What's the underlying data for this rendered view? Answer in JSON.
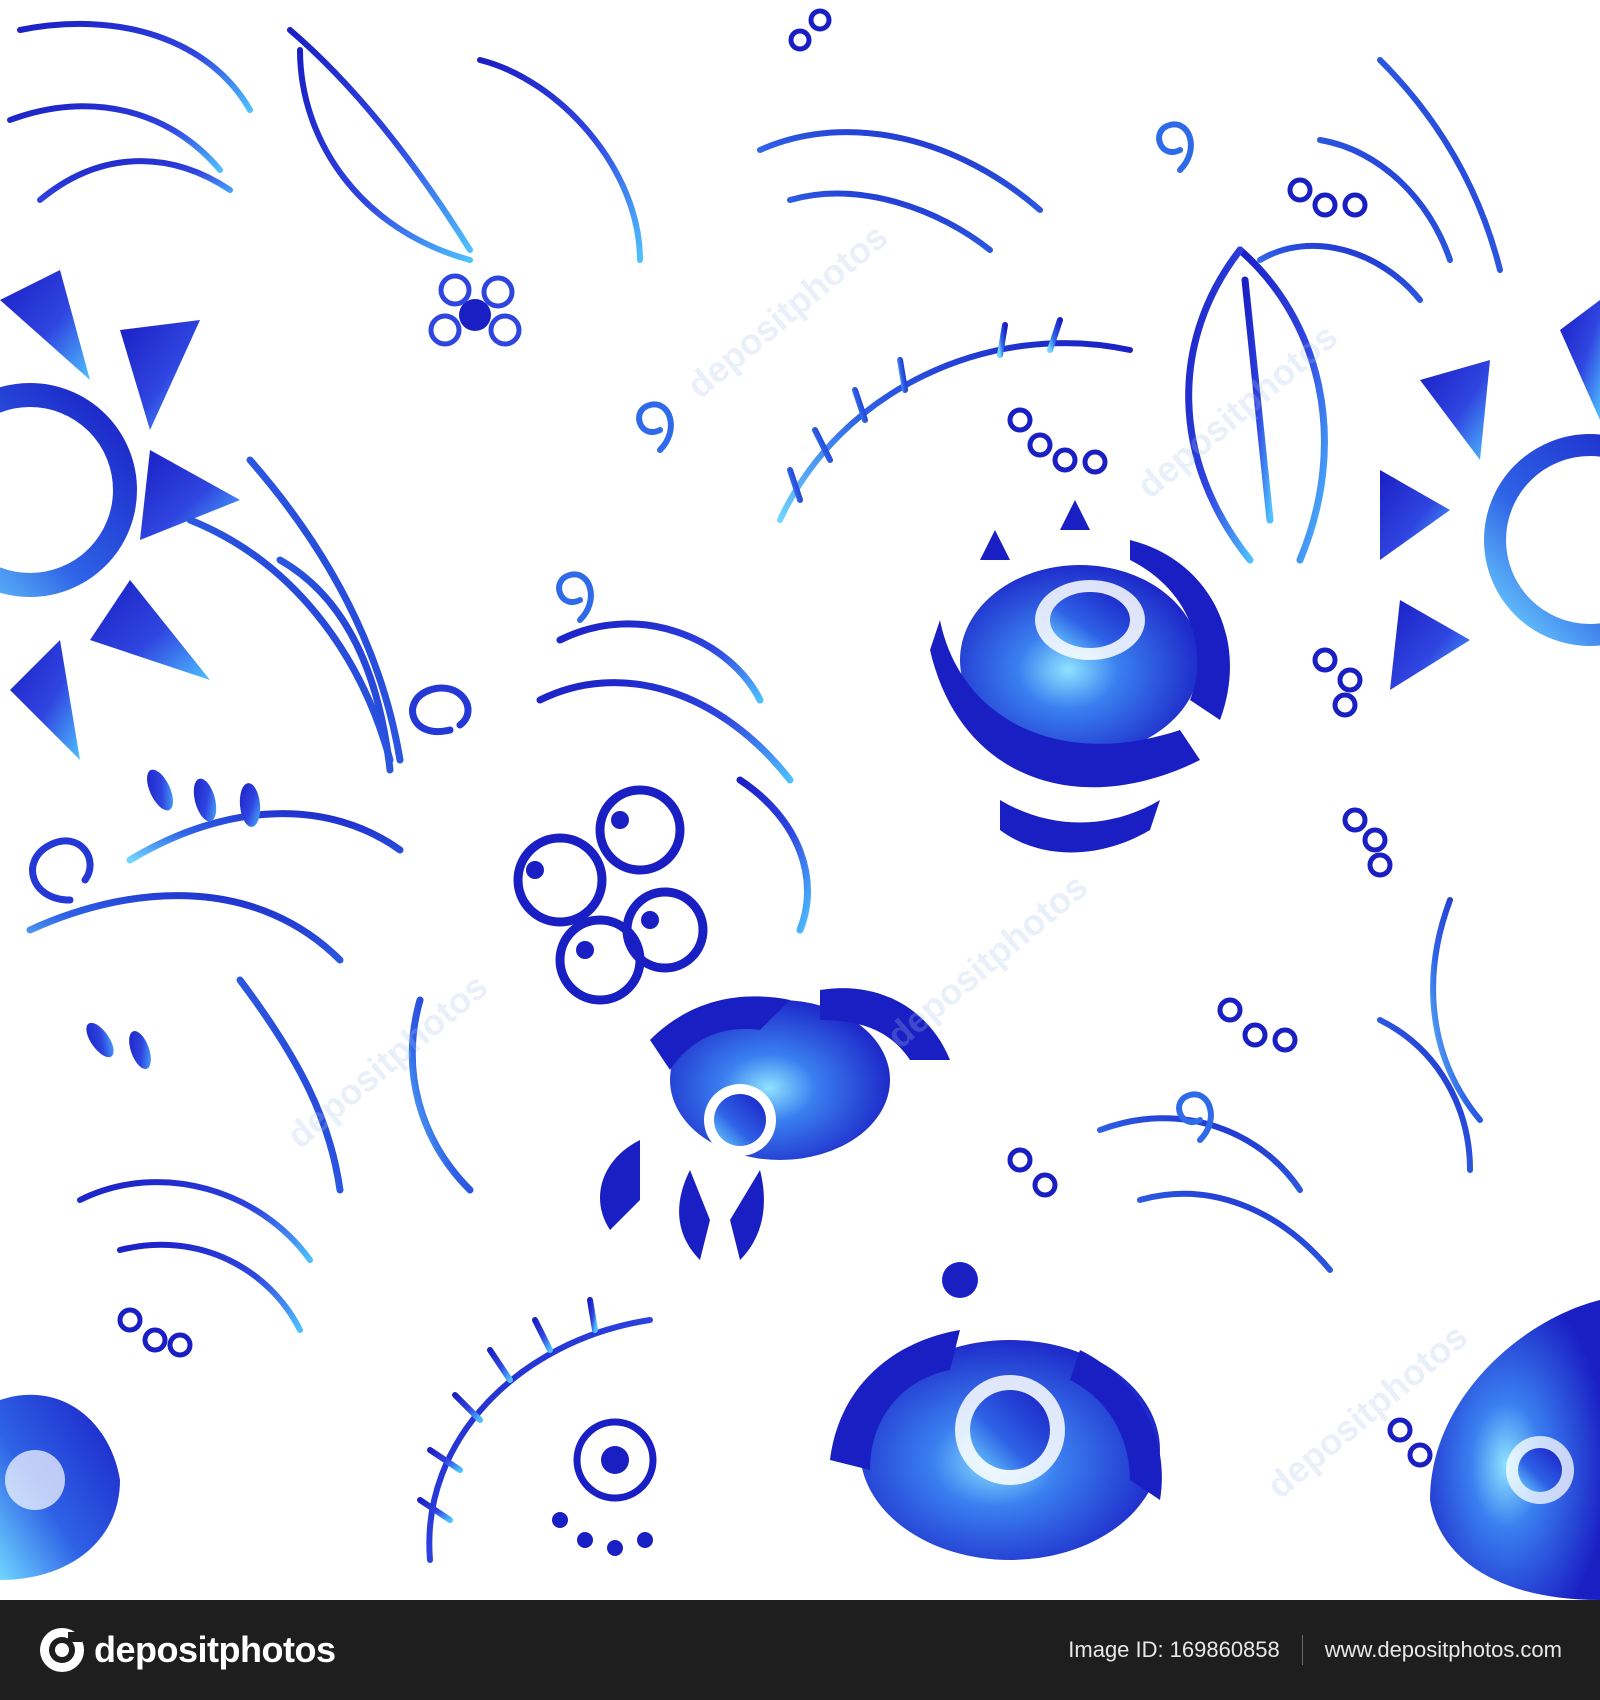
{
  "artwork": {
    "pattern_name": "gzhel-floral-pattern",
    "colors": {
      "background": "#ffffff",
      "cobalt_dark": "#1a1fc4",
      "cobalt": "#2f45e0",
      "azure": "#39a8f0",
      "sky": "#6fd6ff"
    },
    "watermark_text": "depositphotos"
  },
  "footer": {
    "brand": "depositphotos",
    "image_id_label": "Image ID:",
    "image_id": "169860858",
    "url": "www.depositphotos.com",
    "background": "#1e1e1e"
  }
}
